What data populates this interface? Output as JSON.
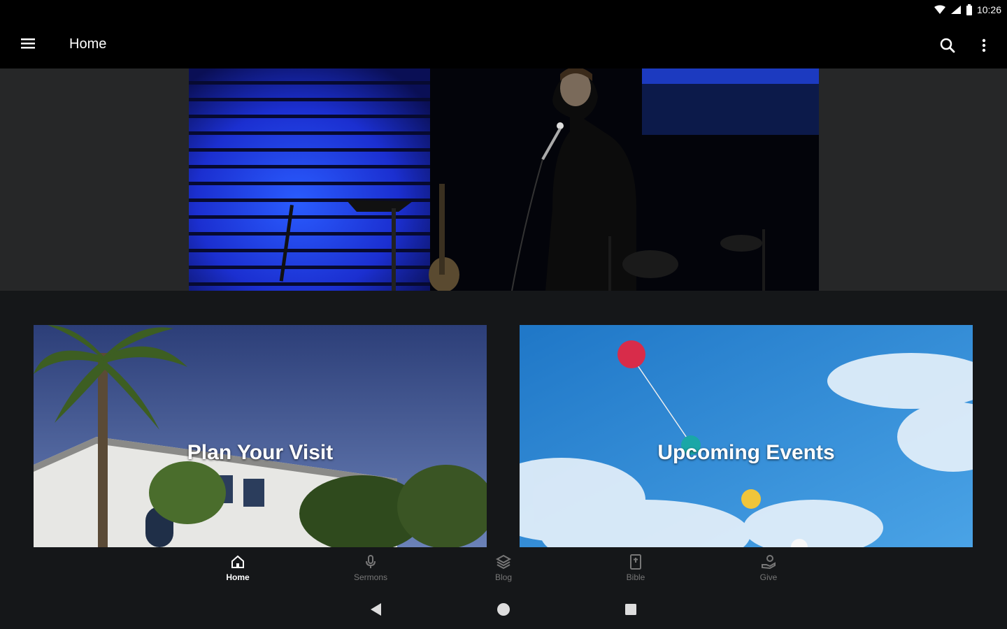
{
  "status_bar": {
    "time": "10:26"
  },
  "app_bar": {
    "title": "Home"
  },
  "cards": [
    {
      "label": "Plan Your Visit"
    },
    {
      "label": "Upcoming Events"
    }
  ],
  "bottom_nav": {
    "items": [
      {
        "label": "Home",
        "icon": "home-icon",
        "active": true
      },
      {
        "label": "Sermons",
        "icon": "microphone-icon",
        "active": false
      },
      {
        "label": "Blog",
        "icon": "layers-icon",
        "active": false
      },
      {
        "label": "Bible",
        "icon": "book-icon",
        "active": false
      },
      {
        "label": "Give",
        "icon": "give-hand-icon",
        "active": false
      }
    ]
  },
  "colors": {
    "app_bar_bg": "#000000",
    "page_bg": "#151719",
    "active_nav": "#ffffff",
    "inactive_nav": "#777777"
  }
}
